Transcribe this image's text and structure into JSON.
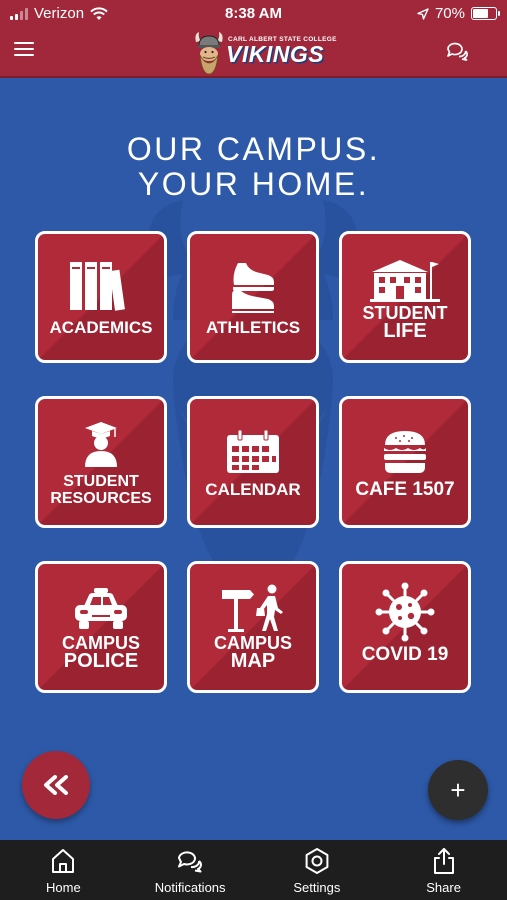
{
  "status_bar": {
    "carrier": "Verizon",
    "time": "8:38 AM",
    "battery": "70%",
    "battery_level": 0.7
  },
  "header": {
    "logo_small": "CARL ALBERT STATE COLLEGE",
    "logo_big": "VIKINGS"
  },
  "main": {
    "headline_line1": "OUR CAMPUS.",
    "headline_line2": "YOUR HOME."
  },
  "tiles": [
    {
      "label": "ACADEMICS",
      "icon": "books-icon"
    },
    {
      "label": "ATHLETICS",
      "icon": "sneakers-icon"
    },
    {
      "label_line1": "STUDENT",
      "label_line2": "LIFE",
      "icon": "school-building-icon"
    },
    {
      "label_line1": "STUDENT",
      "label_line2": "RESOURCES",
      "icon": "graduate-icon"
    },
    {
      "label": "CALENDAR",
      "icon": "calendar-icon"
    },
    {
      "label": "CAFE 1507",
      "icon": "burger-icon"
    },
    {
      "label_line1": "CAMPUS",
      "label_line2": "POLICE",
      "icon": "police-car-icon"
    },
    {
      "label_line1": "CAMPUS",
      "label_line2": "MAP",
      "icon": "signpost-walker-icon"
    },
    {
      "label": "COVID 19",
      "icon": "virus-icon"
    }
  ],
  "fab": {
    "back_icon": "double-chevron-left-icon",
    "add_label": "+"
  },
  "bottom_nav": [
    {
      "label": "Home",
      "icon": "home-icon"
    },
    {
      "label": "Notifications",
      "icon": "chat-bubbles-icon"
    },
    {
      "label": "Settings",
      "icon": "gear-icon"
    },
    {
      "label": "Share",
      "icon": "share-icon"
    }
  ],
  "colors": {
    "brand_red": "#a0283a",
    "background_blue": "#2d59a8",
    "nav_dark": "#1e1e1e"
  }
}
